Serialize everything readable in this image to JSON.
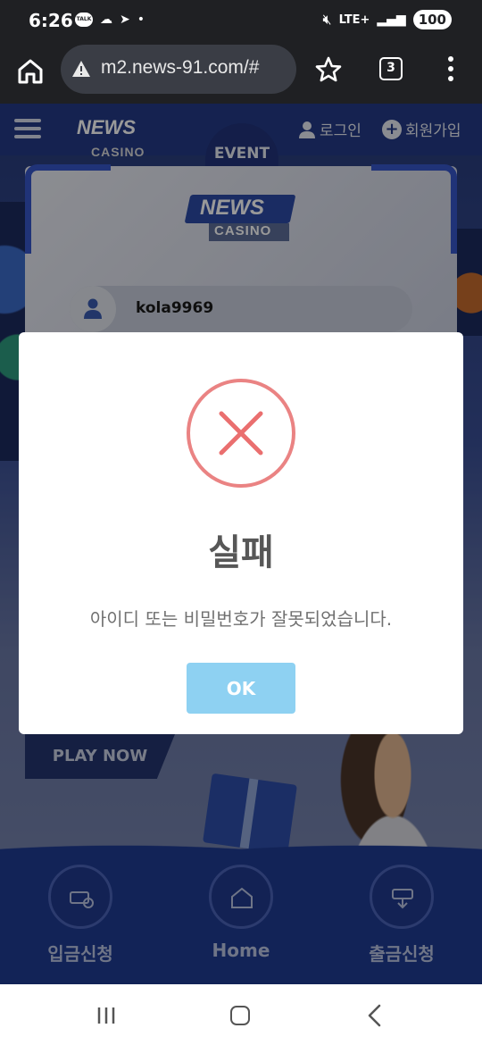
{
  "status_bar": {
    "time": "6:26",
    "talk_badge": "TALK",
    "network": "LTE+",
    "battery": "100"
  },
  "browser": {
    "url": "m2.news-91.com/#",
    "tab_count": "3"
  },
  "site": {
    "login_label": "로그인",
    "signup_label": "회원가입",
    "event_label": "EVENT",
    "logo_news": "NEWS",
    "logo_casino": "CASINO",
    "username_value": "kola9969",
    "play_now": "PLAY NOW",
    "nav": {
      "deposit": "입금신청",
      "home": "Home",
      "withdraw": "출금신청"
    }
  },
  "modal": {
    "title": "실패",
    "message": "아이디 또는 비밀번호가 잘못되었습니다.",
    "ok_label": "OK",
    "accent_color": "#e57373",
    "button_color": "#8ed1f2"
  }
}
